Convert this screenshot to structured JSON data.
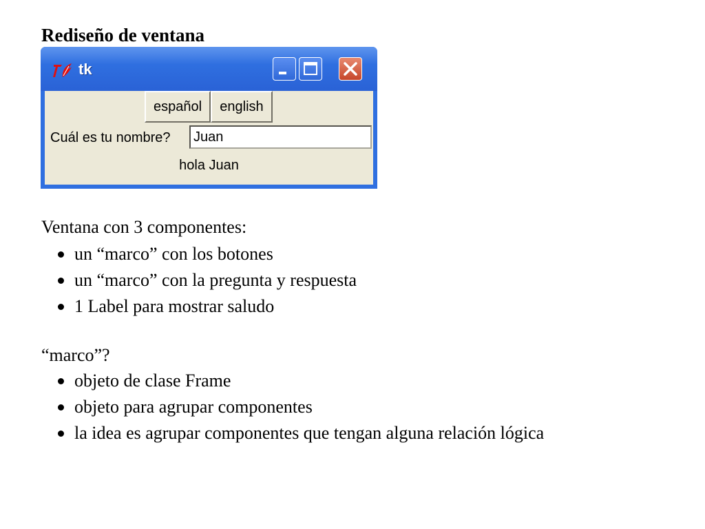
{
  "slide": {
    "title": "Rediseño de ventana"
  },
  "tk_window": {
    "title": "tk",
    "buttons": {
      "spanish_label": "español",
      "english_label": "english"
    },
    "question_label": "Cuál es tu nombre?",
    "name_entry_value": "Juan",
    "greeting_label": "hola Juan",
    "colors": {
      "titlebar": "#2f6fe0",
      "client_background": "#ece9d8",
      "close_button": "#c6462a"
    }
  },
  "section_components": {
    "intro": "Ventana con 3 componentes:",
    "items": [
      "un “marco” con los botones",
      "un “marco” con la pregunta y respuesta",
      "1 Label para mostrar saludo"
    ]
  },
  "section_marco": {
    "intro": "“marco”?",
    "items": [
      "objeto de clase Frame",
      "objeto para agrupar componentes",
      "la idea es agrupar componentes que tengan alguna relación lógica"
    ]
  },
  "icons": {
    "tk_logo": "tk-feather-logo-icon",
    "minimize": "minimize-icon",
    "maximize": "maximize-icon",
    "close": "close-icon",
    "bullet": "bullet-icon"
  }
}
